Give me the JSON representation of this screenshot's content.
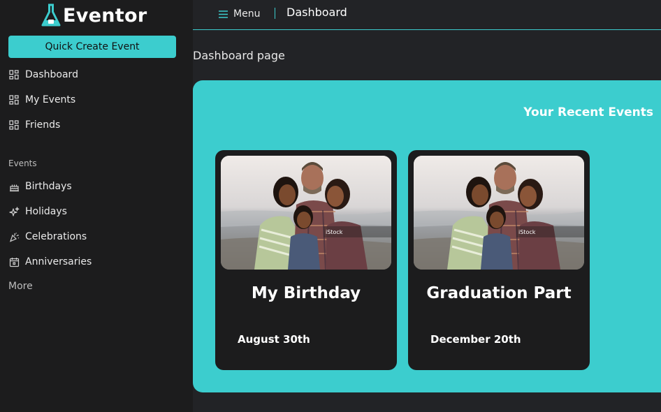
{
  "app": {
    "name": "Eventor",
    "accent_color": "#3ccdce",
    "background_color": "#222326",
    "sidebar_color": "#1c1c1d"
  },
  "sidebar": {
    "quick_create_label": "Quick Create Event",
    "main_items": [
      {
        "label": "Dashboard",
        "icon": "grid-icon"
      },
      {
        "label": "My Events",
        "icon": "grid-icon"
      },
      {
        "label": "Friends",
        "icon": "grid-icon"
      }
    ],
    "events_section_label": "Events",
    "event_items": [
      {
        "label": "Birthdays",
        "icon": "cake-icon"
      },
      {
        "label": "Holidays",
        "icon": "sparkles-icon"
      },
      {
        "label": "Celebrations",
        "icon": "party-popper-icon"
      },
      {
        "label": "Anniversaries",
        "icon": "calendar-icon"
      }
    ],
    "more_label": "More"
  },
  "header": {
    "menu_label": "Menu",
    "menu_icon": "hamburger-icon",
    "title": "Dashboard"
  },
  "main": {
    "page_heading": "Dashboard page",
    "recent_events_title": "Your Recent Events",
    "events": [
      {
        "name": "My Birthday",
        "date": "August 30th",
        "photo_watermark": "iStock"
      },
      {
        "name": "Graduation Part",
        "date": "December 20th",
        "photo_watermark": "iStock"
      }
    ]
  }
}
